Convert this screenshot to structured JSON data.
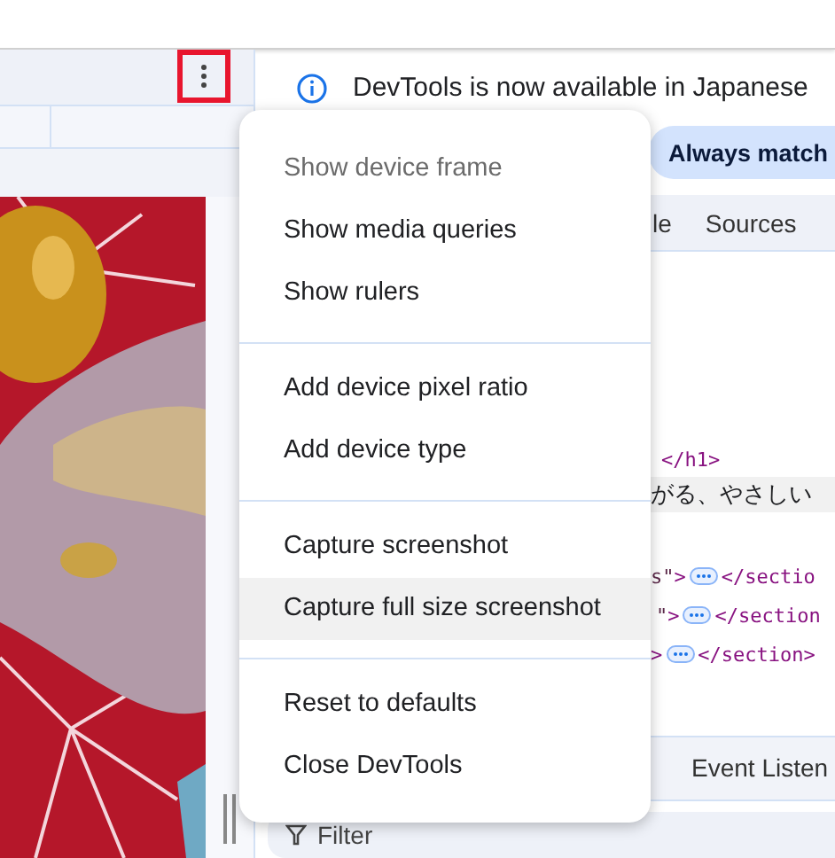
{
  "device_toolbar": {
    "more_button_annotated": true
  },
  "info_bar": {
    "message": "DevTools is now available in Japanese",
    "action": "Always match"
  },
  "tabs": [
    "le",
    "Sources"
  ],
  "code_lines": [
    {
      "highlighted": false,
      "tokens": [
        {
          "kind": "tag",
          "text": "</h1>"
        }
      ]
    },
    {
      "highlighted": true,
      "tokens": [
        {
          "kind": "text",
          "text": "がる、やさしい"
        }
      ]
    },
    {
      "highlighted": false,
      "tokens": [
        {
          "kind": "value",
          "text": "s\""
        },
        {
          "kind": "tag",
          "text": ">"
        },
        {
          "kind": "ellipsis"
        },
        {
          "kind": "tag",
          "text": "</sectio"
        }
      ]
    },
    {
      "highlighted": false,
      "tokens": [
        {
          "kind": "value",
          "text": "\""
        },
        {
          "kind": "tag",
          "text": ">"
        },
        {
          "kind": "ellipsis"
        },
        {
          "kind": "tag",
          "text": "</section"
        }
      ]
    },
    {
      "highlighted": false,
      "tokens": [
        {
          "kind": "tag",
          "text": ">"
        },
        {
          "kind": "ellipsis"
        },
        {
          "kind": "tag",
          "text": "</section>"
        }
      ]
    }
  ],
  "bottom_tabs": [
    "Event Listen"
  ],
  "filter": {
    "placeholder": "Filter"
  },
  "menu": {
    "sections": [
      {
        "items": [
          {
            "label": "Show device frame",
            "disabled": true,
            "highlighted": false
          },
          {
            "label": "Show media queries",
            "disabled": false,
            "highlighted": false
          },
          {
            "label": "Show rulers",
            "disabled": false,
            "highlighted": false
          }
        ]
      },
      {
        "items": [
          {
            "label": "Add device pixel ratio",
            "disabled": false,
            "highlighted": false
          },
          {
            "label": "Add device type",
            "disabled": false,
            "highlighted": false
          }
        ]
      },
      {
        "items": [
          {
            "label": "Capture screenshot",
            "disabled": false,
            "highlighted": false
          },
          {
            "label": "Capture full size screenshot",
            "disabled": false,
            "highlighted": true
          }
        ]
      },
      {
        "items": [
          {
            "label": "Reset to defaults",
            "disabled": false,
            "highlighted": false
          },
          {
            "label": "Close DevTools",
            "disabled": false,
            "highlighted": false
          }
        ]
      }
    ]
  }
}
